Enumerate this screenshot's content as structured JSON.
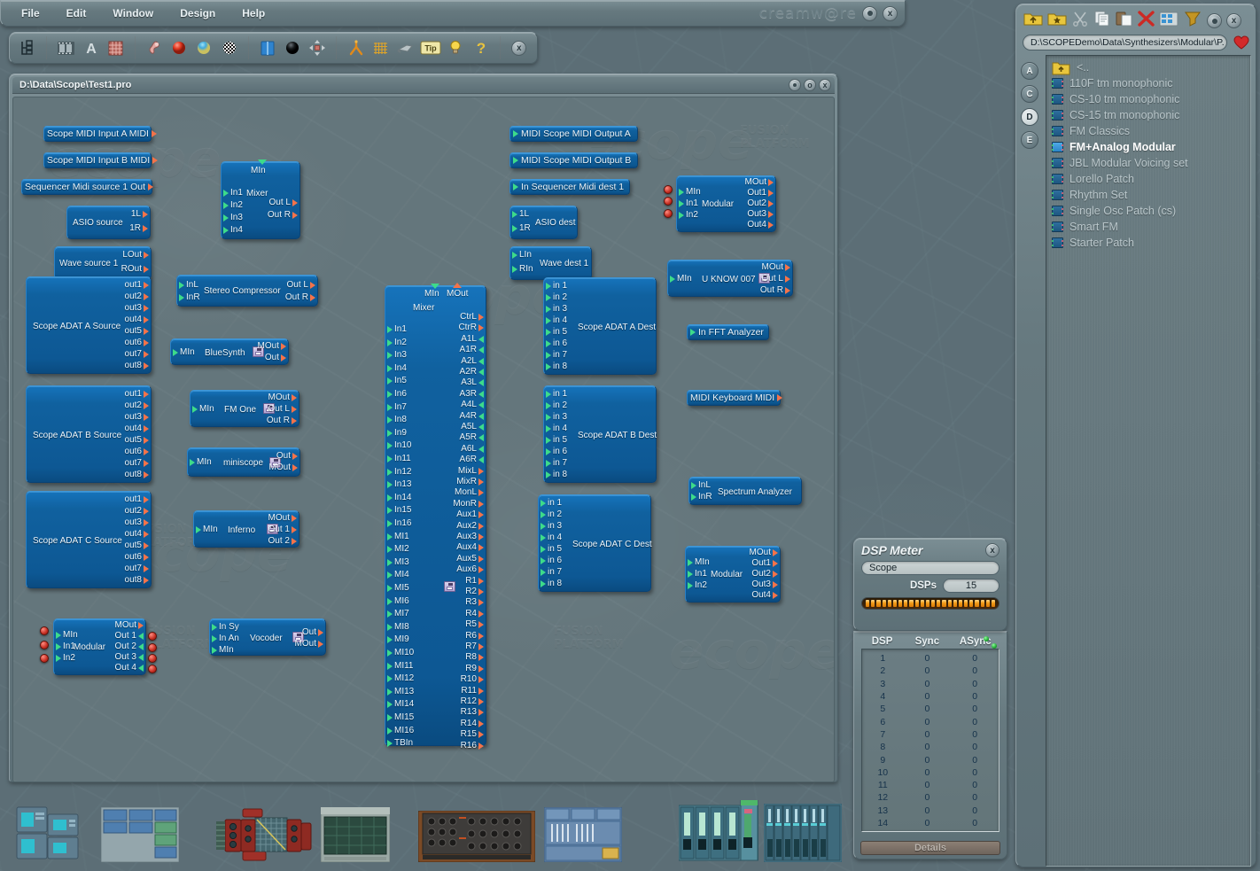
{
  "app": {
    "brand": "creamw@re",
    "menu": [
      "File",
      "Edit",
      "Window",
      "Design",
      "Help"
    ],
    "toolbar_icons": [
      "tree-view-icon",
      "film-strip-icon",
      "text-tool-icon",
      "grid-tool-icon",
      "paint-tool-icon",
      "red-sphere-icon",
      "blue-sphere-icon",
      "checker-sphere-icon",
      "book-icon",
      "black-sphere-icon",
      "move-tool-icon",
      "orange-tripod-icon",
      "grid-icon",
      "wrench-icon",
      "tip-icon",
      "lightbulb-icon",
      "help-icon",
      "close-icon"
    ],
    "tip_label": "Tip"
  },
  "project_window": {
    "title": "D:\\Data\\Scope\\Test1.pro",
    "watermarks": [
      "ecope",
      "FUSION PLATFORM",
      "ecope",
      "FUSION PLATFORM",
      "ecope"
    ]
  },
  "modules": {
    "midi_in_a": {
      "label": "Scope MIDI Input A MIDI"
    },
    "midi_in_b": {
      "label": "Scope MIDI Input B MIDI"
    },
    "seq_src": {
      "label": "Sequencer Midi source 1 Out"
    },
    "asio_src": {
      "label": "ASIO source",
      "outs": [
        "1L",
        "1R"
      ]
    },
    "wave_src": {
      "label": "Wave source 1",
      "outs": [
        "LOut",
        "ROut"
      ]
    },
    "adat_a_src": {
      "label": "Scope ADAT A Source",
      "outs": [
        "out1",
        "out2",
        "out3",
        "out4",
        "out5",
        "out6",
        "out7",
        "out8"
      ]
    },
    "adat_b_src": {
      "label": "Scope ADAT B Source",
      "outs": [
        "out1",
        "out2",
        "out3",
        "out4",
        "out5",
        "out6",
        "out7",
        "out8"
      ]
    },
    "adat_c_src": {
      "label": "Scope ADAT C Source",
      "outs": [
        "out1",
        "out2",
        "out3",
        "out4",
        "out5",
        "out6",
        "out7",
        "out8"
      ]
    },
    "small_mixer": {
      "label": "Mixer",
      "mtop": "MIn",
      "ins": [
        "In1",
        "In2",
        "In3",
        "In4"
      ],
      "outs": [
        "Out L",
        "Out R"
      ]
    },
    "stereo_comp": {
      "label": "Stereo Compressor",
      "ins": [
        "InL",
        "InR"
      ],
      "outs": [
        "Out L",
        "Out R"
      ]
    },
    "bluesynth": {
      "label": "BlueSynth",
      "min": "MIn",
      "outs": [
        "MOut",
        "Out"
      ]
    },
    "fmone": {
      "label": "FM One",
      "min": "MIn",
      "outs": [
        "MOut",
        "Out L",
        "Out R"
      ]
    },
    "miniscope": {
      "label": "miniscope",
      "min": "MIn",
      "outs": [
        "Out",
        "MOut"
      ]
    },
    "inferno": {
      "label": "Inferno",
      "min": "MIn",
      "outs": [
        "MOut",
        "Out 1",
        "Out 2"
      ]
    },
    "modular_left": {
      "label": "Modular",
      "ins": [
        "MIn",
        "In1",
        "In2"
      ],
      "outs": [
        "MOut",
        "Out 1",
        "Out 2",
        "Out 3",
        "Out 4"
      ]
    },
    "vocoder": {
      "label": "Vocoder",
      "ins": [
        "In Sy",
        "In An",
        "MIn"
      ],
      "outs": [
        "Out",
        "MOut"
      ]
    },
    "big_mixer": {
      "label": "Mixer",
      "mtop": "MIn",
      "mtop2": "MOut",
      "ins": [
        "In1",
        "In2",
        "In3",
        "In4",
        "In5",
        "In6",
        "In7",
        "In8",
        "In9",
        "In10",
        "In11",
        "In12",
        "In13",
        "In14",
        "In15",
        "In16",
        "MI1",
        "MI2",
        "MI3",
        "MI4",
        "MI5",
        "MI6",
        "MI7",
        "MI8",
        "MI9",
        "MI10",
        "MI11",
        "MI12",
        "MI13",
        "MI14",
        "MI15",
        "MI16",
        "TBIn"
      ],
      "outs": [
        "CtrL",
        "CtrR",
        "A1L",
        "A1R",
        "A2L",
        "A2R",
        "A3L",
        "A3R",
        "A4L",
        "A4R",
        "A5L",
        "A5R",
        "A6L",
        "A6R",
        "MixL",
        "MixR",
        "MonL",
        "MonR",
        "Aux1",
        "Aux2",
        "Aux3",
        "Aux4",
        "Aux5",
        "Aux6",
        "R1",
        "R2",
        "R3",
        "R4",
        "R5",
        "R6",
        "R7",
        "R8",
        "R9",
        "R10",
        "R11",
        "R12",
        "R13",
        "R14",
        "R15",
        "R16"
      ]
    },
    "midi_out_a": {
      "label": "MIDI Scope MIDI Output A"
    },
    "midi_out_b": {
      "label": "MIDI Scope MIDI Output B"
    },
    "seq_dest": {
      "label": "In Sequencer Midi dest 1"
    },
    "asio_dest": {
      "label": "ASIO dest",
      "ins": [
        "1L",
        "1R"
      ]
    },
    "wave_dest": {
      "label": "Wave dest 1",
      "ins": [
        "LIn",
        "RIn"
      ]
    },
    "adat_a_dst": {
      "label": "Scope ADAT A Dest",
      "ins": [
        "in 1",
        "in 2",
        "in 3",
        "in 4",
        "in 5",
        "in 6",
        "in 7",
        "in 8"
      ]
    },
    "adat_b_dst": {
      "label": "Scope ADAT B Dest",
      "ins": [
        "in 1",
        "in 2",
        "in 3",
        "in 4",
        "in 5",
        "in 6",
        "in 7",
        "in 8"
      ]
    },
    "adat_c_dst": {
      "label": "Scope ADAT C Dest",
      "ins": [
        "in 1",
        "in 2",
        "in 3",
        "in 4",
        "in 5",
        "in 6",
        "in 7",
        "in 8"
      ]
    },
    "modular_top": {
      "label": "Modular",
      "ins": [
        "MIn",
        "In1",
        "In2"
      ],
      "outs": [
        "MOut",
        "Out1",
        "Out2",
        "Out3",
        "Out4"
      ]
    },
    "uknow": {
      "label": "U KNOW 007",
      "min": "MIn",
      "outs": [
        "MOut",
        "Out L",
        "Out R"
      ]
    },
    "fft": {
      "label": "In FFT Analyzer"
    },
    "midi_kbd": {
      "label": "MIDI Keyboard MIDI"
    },
    "spectrum": {
      "label": "Spectrum Analyzer",
      "ins": [
        "InL",
        "InR"
      ]
    },
    "modular_right": {
      "label": "Modular",
      "ins": [
        "MIn",
        "In1",
        "In2"
      ],
      "outs": [
        "MOut",
        "Out1",
        "Out2",
        "Out3",
        "Out4"
      ]
    }
  },
  "dsp_meter": {
    "title": "DSP Meter",
    "device": "Scope",
    "dsps_label": "DSPs",
    "dsps_value": "15",
    "bar_segments": 24,
    "columns": [
      "DSP",
      "Sync",
      "ASync"
    ],
    "rows": [
      [
        "1",
        "0",
        "0"
      ],
      [
        "2",
        "0",
        "0"
      ],
      [
        "3",
        "0",
        "0"
      ],
      [
        "4",
        "0",
        "0"
      ],
      [
        "5",
        "0",
        "0"
      ],
      [
        "6",
        "0",
        "0"
      ],
      [
        "7",
        "0",
        "0"
      ],
      [
        "8",
        "0",
        "0"
      ],
      [
        "9",
        "0",
        "0"
      ],
      [
        "10",
        "0",
        "0"
      ],
      [
        "11",
        "0",
        "0"
      ],
      [
        "12",
        "0",
        "0"
      ],
      [
        "13",
        "0",
        "0"
      ],
      [
        "14",
        "0",
        "0"
      ]
    ],
    "details_label": "Details"
  },
  "browser": {
    "toolbar_icons": [
      "folder-up-icon",
      "folder-new-icon",
      "cut-icon",
      "copy-icon",
      "paste-icon",
      "delete-icon",
      "properties-icon",
      "export-icon",
      "record-icon",
      "close-icon"
    ],
    "path": "D:\\SCOPEDemo\\Data\\Synthesizers\\Modular\\P.",
    "favorite_icon": "heart-icon",
    "drives": [
      "A",
      "C",
      "D",
      "E"
    ],
    "selected_drive": "D",
    "items": [
      {
        "label": "<..",
        "icon": "folder-up-icon",
        "selected": false
      },
      {
        "label": "110F tm monophonic",
        "icon": "patch-icon",
        "selected": false
      },
      {
        "label": "CS-10 tm monophonic",
        "icon": "patch-icon",
        "selected": false
      },
      {
        "label": "CS-15 tm monophonic",
        "icon": "patch-icon",
        "selected": false
      },
      {
        "label": "FM Classics",
        "icon": "patch-icon",
        "selected": false
      },
      {
        "label": "FM+Analog Modular",
        "icon": "patch-icon",
        "selected": true
      },
      {
        "label": "JBL Modular Voicing set",
        "icon": "patch-icon",
        "selected": false
      },
      {
        "label": "Lorello Patch",
        "icon": "patch-icon",
        "selected": false
      },
      {
        "label": "Rhythm Set",
        "icon": "patch-icon",
        "selected": false
      },
      {
        "label": "Single Osc Patch (cs)",
        "icon": "patch-icon",
        "selected": false
      },
      {
        "label": "Smart FM",
        "icon": "patch-icon",
        "selected": false
      },
      {
        "label": "Starter Patch",
        "icon": "patch-icon",
        "selected": false
      }
    ]
  },
  "taskbar": {
    "items": [
      "devices-thumbnail",
      "routing-window-thumbnail",
      "modular-rack-thumbnail",
      "analyzer-thumbnail",
      "analog-synth-thumbnail",
      "mixer-strip-thumbnail",
      "channel-mixer-thumbnail",
      "large-mixer-thumbnail"
    ]
  },
  "colors": {
    "module_blue": "#10619f",
    "desktop": "#5f737b",
    "panel": "#66797f",
    "accent_green": "#3ddb8a",
    "accent_red": "#f4734a",
    "meter_orange": "#f29b18"
  }
}
